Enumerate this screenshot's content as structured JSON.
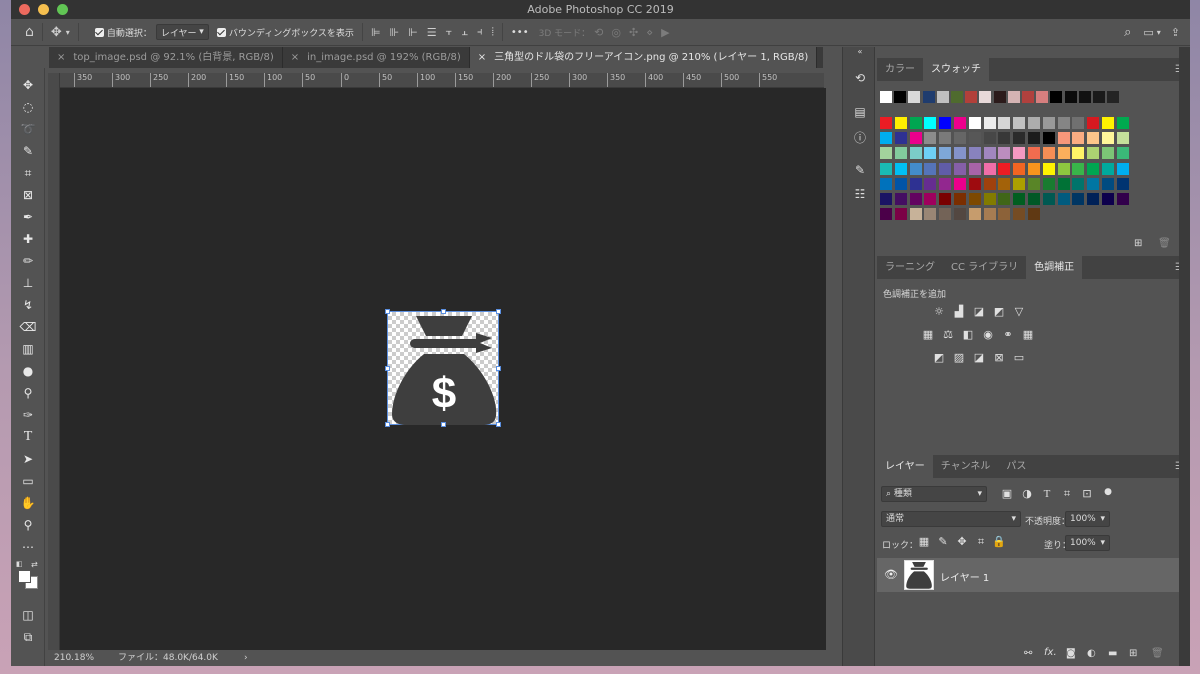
{
  "app": {
    "title": "Adobe Photoshop CC 2019"
  },
  "colors": {
    "accent": "#5b8fe0",
    "canvas_bg": "#282828",
    "panel_bg": "#535353",
    "dark_bar": "#424242"
  },
  "options": {
    "auto_select_label": "自動選択：",
    "auto_select_value": "レイヤー",
    "bbox_label": "バウンディングボックスを表示",
    "more": "•••",
    "mode3d_label": "3D モード："
  },
  "tabs": [
    {
      "close": "×",
      "label": "top_image.psd @ 92.1% (白背景, RGB/8)"
    },
    {
      "close": "×",
      "label": "in_image.psd @ 192% (RGB/8)"
    },
    {
      "close": "×",
      "label": "三角型のドル袋のフリーアイコン.png @ 210% (レイヤー 1, RGB/8)"
    }
  ],
  "ruler": {
    "h": [
      "350",
      "300",
      "250",
      "200",
      "150",
      "100",
      "50",
      "0",
      "50",
      "100",
      "150",
      "200",
      "250",
      "300",
      "350",
      "400",
      "450",
      "500",
      "550"
    ]
  },
  "status": {
    "zoom": "210.18%",
    "file_info": "ファイル：48.0K/64.0K",
    "arrow": "›"
  },
  "color_panel": {
    "tabs": [
      "カラー",
      "スウォッチ"
    ]
  },
  "swatches": {
    "row0": [
      "#ffffff",
      "#000000",
      "#d9d9d9",
      "#1f3c6e",
      "#c0c0c0",
      "#4f6b2e",
      "#b2403a",
      "#e8d9d9",
      "#2b1a1a",
      "#d4b3b3",
      "#b0413e",
      "#d67f7f",
      "#000000",
      "#0b0b0b",
      "#111111",
      "#1a1a1a",
      "#242424"
    ],
    "rows": [
      [
        "#ec1c24",
        "#ffef00",
        "#00a651",
        "#00ffff",
        "#0000ff",
        "#ec008c",
        "#ffffff",
        "#ebebeb",
        "#d6d6d6",
        "#c2c2c2",
        "#adadad",
        "#999999",
        "#858585",
        "#707070",
        "#d71920",
        "#fff200",
        "#00a94f"
      ],
      [
        "#00aeef",
        "#2e3192",
        "#ec008c",
        "#8c8c8c",
        "#7a7a7a",
        "#666666",
        "#575757",
        "#474747",
        "#383838",
        "#2b2b2b",
        "#1c1c1c",
        "#000000",
        "#f7977a",
        "#fbad82",
        "#fdc68a",
        "#fff79a",
        "#c4df9b"
      ],
      [
        "#a3d39c",
        "#82ca9d",
        "#7bcdc8",
        "#6ecff6",
        "#7ea7d8",
        "#8493ca",
        "#8882be",
        "#a186be",
        "#bc8dbf",
        "#f49ac2",
        "#f26c4f",
        "#f68e55",
        "#fbaf5c",
        "#fff467",
        "#acd372",
        "#7cc576",
        "#3bb878"
      ],
      [
        "#1abbb4",
        "#00bff3",
        "#438ccb",
        "#5574b9",
        "#605ca8",
        "#855fa8",
        "#a763a8",
        "#f06ea9",
        "#ed1c24",
        "#f26522",
        "#f7941d",
        "#fff200",
        "#8dc63f",
        "#39b54a",
        "#00a651",
        "#00a99d",
        "#00aeef"
      ],
      [
        "#0072bc",
        "#0054a6",
        "#2e3192",
        "#662d91",
        "#92278f",
        "#ec008c",
        "#9e0b0f",
        "#a0410d",
        "#a36209",
        "#aba000",
        "#598527",
        "#197b30",
        "#007236",
        "#00746b",
        "#0076a3",
        "#004b80",
        "#003471"
      ],
      [
        "#1b1464",
        "#440e62",
        "#630460",
        "#9e005d",
        "#790000",
        "#7b2e00",
        "#7d4900",
        "#827b00",
        "#406618",
        "#005e20",
        "#005826",
        "#005952",
        "#005b7f",
        "#003663",
        "#002157",
        "#0d004c",
        "#32004b"
      ],
      [
        "#4b0049",
        "#7b0046",
        "#c7b299",
        "#998675",
        "#736357",
        "#534741",
        "#c69c6d",
        "#a67c52",
        "#8c6239",
        "#754c24",
        "#603913"
      ]
    ]
  },
  "adjust_panel": {
    "tabs": [
      "ラーニング",
      "CC ライブラリ",
      "色調補正"
    ],
    "add_label": "色調補正を追加"
  },
  "layers_panel": {
    "tabs": [
      "レイヤー",
      "チャンネル",
      "パス"
    ],
    "filter_kind": "種類",
    "blend_mode": "通常",
    "opacity_label": "不透明度：",
    "opacity_value": "100%",
    "lock_label": "ロック：",
    "fill_label": "塗り：",
    "fill_value": "100%",
    "layer_name": "レイヤー 1",
    "fx_label": "fx."
  }
}
